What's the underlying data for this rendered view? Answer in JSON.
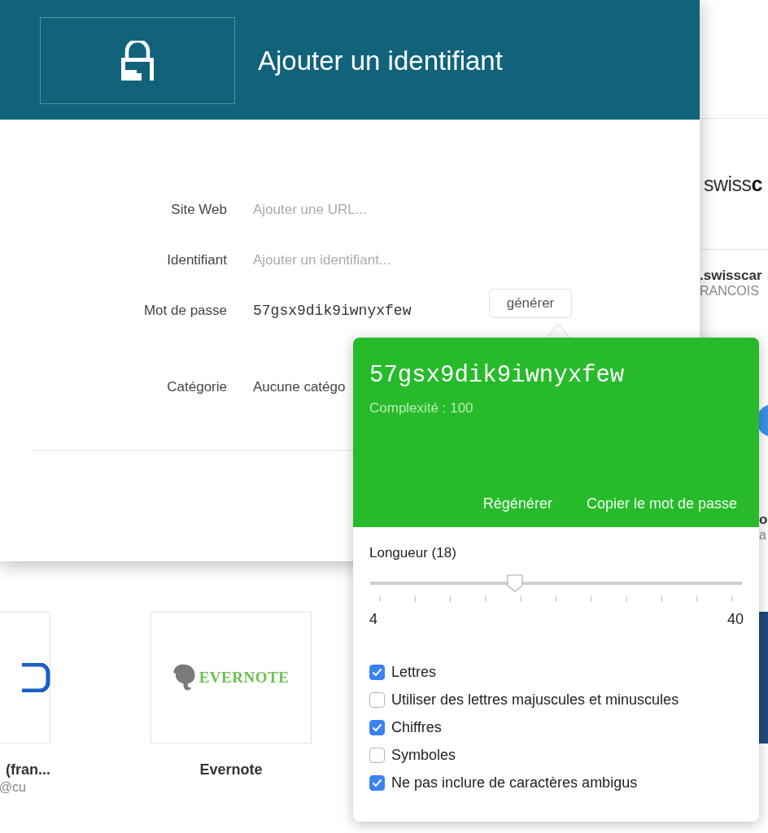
{
  "background": {
    "top_card": {
      "logo": "swiss**c**",
      "title": ".swisscar",
      "subtitle": "RANCOIS"
    },
    "side_card": {
      "title": "o",
      "subtitle": "a"
    },
    "bottom_cards": [
      {
        "kind": "outline",
        "title": "(fran...",
        "subtitle": "@cu"
      },
      {
        "kind": "evernote",
        "logo": "EVERNOTE",
        "title": "Evernote"
      },
      {
        "kind": "dark"
      }
    ]
  },
  "dialog": {
    "title": "Ajouter un identifiant",
    "generate_button": "générer",
    "fields": [
      {
        "kind": "text",
        "label": "Site Web",
        "placeholder": "Ajouter une URL..."
      },
      {
        "kind": "text",
        "label": "Identifiant",
        "placeholder": "Ajouter un identifiant..."
      },
      {
        "kind": "password",
        "label": "Mot de passe",
        "value": "57gsx9dik9iwnyxfew"
      },
      {
        "kind": "select",
        "label": "Catégorie",
        "value": "Aucune catégo"
      }
    ]
  },
  "generator": {
    "password": "57gsx9dik9iwnyxfew",
    "complexity": "Complexité : 100",
    "actions": [
      "Régénérer",
      "Copier le mot de passe"
    ],
    "length": {
      "label": "Longueur (18)",
      "level": 0.389,
      "min": "4",
      "max": "40"
    },
    "options": [
      {
        "label": "Lettres",
        "checked": true
      },
      {
        "label": "Utiliser des lettres majuscules et minuscules",
        "checked": false
      },
      {
        "label": "Chiffres",
        "checked": true
      },
      {
        "label": "Symboles",
        "checked": false
      },
      {
        "label": "Ne pas inclure de caractères ambigus",
        "checked": true
      }
    ]
  }
}
